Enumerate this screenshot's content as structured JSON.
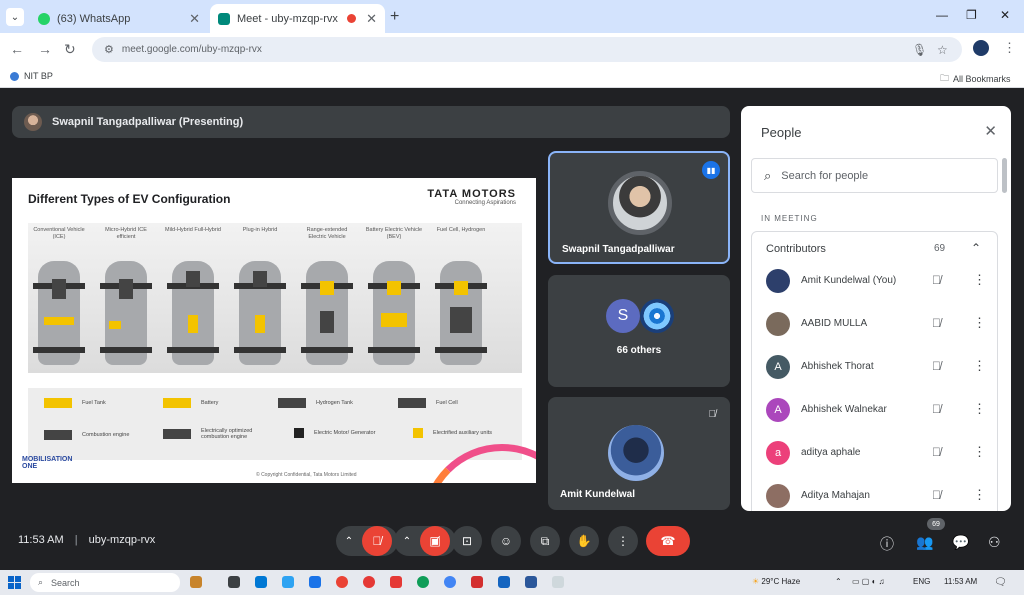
{
  "browser": {
    "tabs": [
      {
        "title": "(63) WhatsApp",
        "favicon_color": "#25d366",
        "active": false
      },
      {
        "title": "Meet - uby-mzqp-rvx",
        "favicon_color": "#00897b",
        "active": true
      }
    ],
    "tab_close": "✕",
    "new_tab": "+",
    "url": "meet.google.com/uby-mzqp-rvx",
    "bookmarks_left": "NIT BP",
    "bookmarks_right": "All Bookmarks"
  },
  "meet": {
    "presenter_label": "Swapnil Tangadpalliwar (Presenting)",
    "slide": {
      "title": "Different Types of EV Configuration",
      "brand": "TATA MOTORS",
      "brand_tagline": "Connecting Aspirations",
      "columns": [
        "Conventional Vehicle (ICE)",
        "Micro-Hybrid ICE efficient",
        "Mild-Hybrid Full-Hybrid",
        "Plug-in Hybrid",
        "Range-extended Electric Vehicle",
        "Battery Electric Vehicle (BEV)",
        "Fuel Cell, Hydrogen"
      ],
      "legend": [
        {
          "label": "Fuel Tank",
          "color": "#f3c300"
        },
        {
          "label": "Battery",
          "color": "#f3c300"
        },
        {
          "label": "Hydrogen Tank",
          "color": "#444444"
        },
        {
          "label": "Fuel Cell",
          "color": "#444444"
        },
        {
          "label": "Combustion engine",
          "color": "#444444"
        },
        {
          "label": "Electrically optimized combustion engine",
          "color": "#444444"
        },
        {
          "label": "Electric Motor/ Generator",
          "color": "#222222"
        },
        {
          "label": "Electrified auxiliary units",
          "color": "#f3c300"
        }
      ],
      "footer": "© Copyright Confidential, Tata Motors Limited",
      "logo_line1": "MOBILISATION",
      "logo_line2": "ONE"
    },
    "tiles": [
      {
        "name": "Swapnil Tangadpalliwar",
        "speaking": true
      },
      {
        "name": "66 others",
        "avatar_letter": "S",
        "avatar_color": "#5c6bc0"
      },
      {
        "name": "Amit Kundelwal"
      }
    ],
    "people": {
      "title": "People",
      "search_placeholder": "Search for people",
      "section": "IN MEETING",
      "group": "Contributors",
      "count": "69",
      "rows": [
        {
          "name": "Amit Kundelwal (You)",
          "letter": "",
          "color": "#2d3f6b"
        },
        {
          "name": "AABID MULLA",
          "letter": "",
          "color": "#7a6a5c"
        },
        {
          "name": "Abhishek Thorat",
          "letter": "A",
          "color": "#455a64"
        },
        {
          "name": "Abhishek Walnekar",
          "letter": "A",
          "color": "#ab47bc"
        },
        {
          "name": "aditya aphale",
          "letter": "a",
          "color": "#ec407a"
        },
        {
          "name": "Aditya Mahajan",
          "letter": "",
          "color": "#8d6e63"
        }
      ]
    },
    "bottom": {
      "time": "11:53 AM",
      "code": "uby-mzqp-rvx",
      "people_badge": "69"
    }
  },
  "taskbar": {
    "search": "Search",
    "weather": "29°C Haze",
    "lang": "ENG",
    "clock": "11:53 AM",
    "apps": [
      "#c8842b",
      "#3c4043",
      "#0078d4",
      "#2ea3f2",
      "#1a73e8",
      "#ea4335",
      "#e53935",
      "#0f9d58",
      "#4285f4",
      "#d32f2f",
      "#1565c0",
      "#2b579a",
      "#cfd8dc"
    ]
  }
}
